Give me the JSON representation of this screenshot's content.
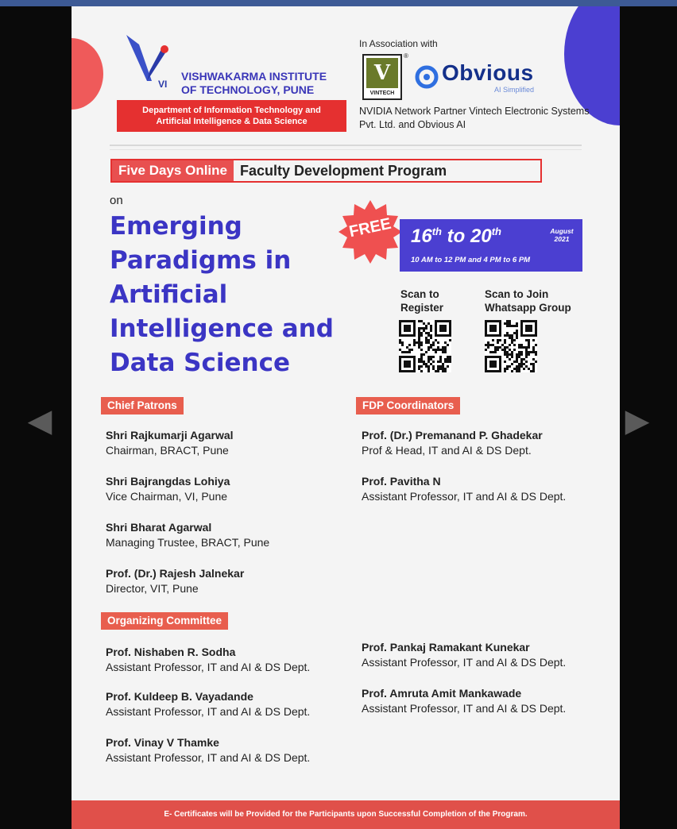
{
  "colors": {
    "accent_blue": "#4b3fd1",
    "accent_red": "#e53030",
    "section_label": "#e85e4e",
    "footer": "#e0504a",
    "title_color": "#3b35c4"
  },
  "nav": {
    "prev_icon": "triangle-left-icon",
    "next_icon": "triangle-right-icon"
  },
  "header": {
    "institute_lines": [
      "VISHWAKARMA INSTITUTE",
      "OF TECHNOLOGY, PUNE"
    ],
    "logo_mark": "VI",
    "department_lines": [
      "Department of Information Technology and",
      "Artificial Intelligence & Data Science"
    ]
  },
  "association": {
    "label": "In Association with",
    "vintech_label": "VINTECH",
    "vintech_mark": "V",
    "obvious_name": "Obvious",
    "obvious_tagline": "AI Simplified",
    "description": "NVIDIA Network Partner Vintech Electronic Systems Pvt. Ltd. and Obvious AI"
  },
  "program": {
    "online_label": "Five Days Online",
    "program_label": "Faculty Development Program",
    "on_label": "on",
    "title": "Emerging Paradigms in Artificial Intelligence and Data Science",
    "free_label": "FREE",
    "date_start": "16",
    "date_start_suffix": "th",
    "date_to": "to",
    "date_end": "20",
    "date_end_suffix": "th",
    "month": "August",
    "year": "2021",
    "time": "10 AM to 12 PM and 4 PM to 6 PM"
  },
  "scan": {
    "register_lines": [
      "Scan to",
      "Register"
    ],
    "whatsapp_lines": [
      "Scan to Join",
      "Whatsapp Group"
    ]
  },
  "sections": {
    "chief_patrons_label": "Chief Patrons",
    "coordinators_label": "FDP Coordinators",
    "organizing_label": "Organizing Committee"
  },
  "chief_patrons": [
    {
      "name": "Shri  Rajkumarji Agarwal",
      "role": "Chairman, BRACT, Pune"
    },
    {
      "name": "Shri Bajrangdas Lohiya",
      "role": "Vice Chairman, VI, Pune"
    },
    {
      "name": "Shri Bharat Agarwal",
      "role": "Managing Trustee, BRACT, Pune"
    },
    {
      "name": "Prof. (Dr.) Rajesh Jalnekar",
      "role": "Director, VIT, Pune"
    }
  ],
  "coordinators": [
    {
      "name": "Prof. (Dr.) Premanand P. Ghadekar",
      "role": "Prof & Head, IT and AI & DS Dept."
    },
    {
      "name": "Prof. Pavitha N",
      "role": "Assistant Professor, IT and AI & DS Dept."
    }
  ],
  "organizing_committee": [
    {
      "name": "Prof. Nishaben R. Sodha",
      "role": "Assistant Professor, IT and AI & DS Dept."
    },
    {
      "name": "Prof. Kuldeep B. Vayadande",
      "role": "Assistant Professor, IT and AI & DS Dept."
    },
    {
      "name": "Prof. Vinay V Thamke",
      "role": "Assistant Professor, IT and AI & DS Dept."
    },
    {
      "name": "Prof. Pankaj Ramakant Kunekar",
      "role": "Assistant Professor, IT and AI & DS Dept."
    },
    {
      "name": "Prof. Amruta Amit Mankawade",
      "role": "Assistant Professor, IT and AI & DS Dept."
    }
  ],
  "footer": {
    "text": "E- Certificates will be Provided for the Participants upon Successful Completion of the Program."
  }
}
